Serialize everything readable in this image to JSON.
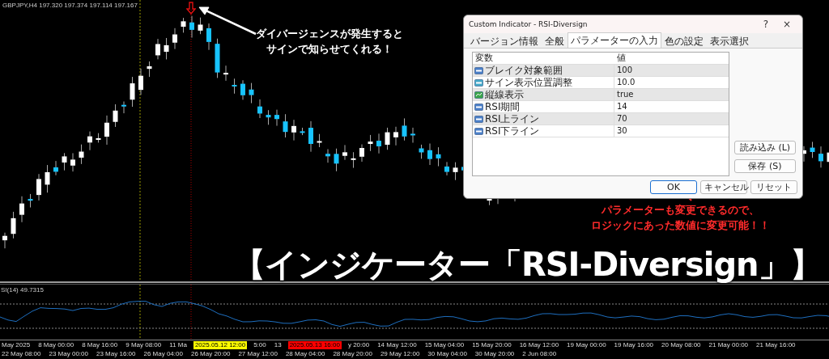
{
  "chart": {
    "header": "GBPJPY,H4  197.320 197.374 197.114 197.167",
    "callout_top": [
      "ダイバージェンスが発生すると",
      "サインで知らせてくれる！"
    ],
    "callout_bottom": [
      "パラメーターも変更できるので、",
      "ロジックにあった数値に変更可能！！"
    ],
    "headline": "【インジケーター「RSI-Diversign」】"
  },
  "dialog": {
    "title": "Custom Indicator - RSI-Diversign",
    "help": "?",
    "close": "×",
    "tabs": [
      {
        "label": "バージョン情報",
        "selected": false
      },
      {
        "label": "全般",
        "selected": false
      },
      {
        "label": "パラメーターの入力",
        "selected": true
      },
      {
        "label": "色の設定",
        "selected": false
      },
      {
        "label": "表示選択",
        "selected": false
      }
    ],
    "columns": [
      "変数",
      "値"
    ],
    "rows": [
      {
        "kind": "int",
        "name": "ブレイク対象範囲",
        "value": "100"
      },
      {
        "kind": "double",
        "name": "サイン表示位置調整",
        "value": "10.0"
      },
      {
        "kind": "bool",
        "name": "縦線表示",
        "value": "true"
      },
      {
        "kind": "int",
        "name": "RSI期間",
        "value": "14"
      },
      {
        "kind": "int",
        "name": "RSI上ライン",
        "value": "70"
      },
      {
        "kind": "int",
        "name": "RSI下ライン",
        "value": "30"
      }
    ],
    "side_buttons": [
      "読み込み (L)",
      "保存 (S)"
    ],
    "buttons": [
      {
        "label": "OK",
        "default": true
      },
      {
        "label": "キャンセル",
        "default": false
      },
      {
        "label": "リセット",
        "default": false
      }
    ]
  },
  "indicator": {
    "label": "SI(14) 49.7315"
  },
  "time_axis": [
    {
      "text": "May 2025"
    },
    {
      "text": "8 May 00:00"
    },
    {
      "text": "8 May 16:00"
    },
    {
      "text": "9 May 08:00"
    },
    {
      "text": "11 Ma"
    },
    {
      "text": "2025.05.12 12:00",
      "color": "#ffff00"
    },
    {
      "text": "5:00"
    },
    {
      "text": "13"
    },
    {
      "text": "2025.05.13 16:00",
      "color": "#ff0000"
    },
    {
      "text": "y 20:00"
    },
    {
      "text": "14 May 12:00"
    },
    {
      "text": "15 May 04:00"
    },
    {
      "text": "15 May 20:00"
    },
    {
      "text": "16 May 12:00"
    },
    {
      "text": "19 May 00:00"
    },
    {
      "text": "19 May 16:00"
    },
    {
      "text": "20 May 08:00"
    },
    {
      "text": "21 May 00:00"
    },
    {
      "text": "21 May 16:00"
    },
    {
      "text": "22 May 08:00"
    },
    {
      "text": "23 May 00:00"
    },
    {
      "text": "23 May 16:00"
    },
    {
      "text": "26 May 04:00"
    },
    {
      "text": "26 May 20:00"
    },
    {
      "text": "27 May 12:00"
    },
    {
      "text": "28 May 04:00"
    },
    {
      "text": "28 May 20:00"
    },
    {
      "text": "29 May 12:00"
    },
    {
      "text": "30 May 04:00"
    },
    {
      "text": "30 May 20:00"
    },
    {
      "text": "2 Jun 08:00"
    }
  ]
}
